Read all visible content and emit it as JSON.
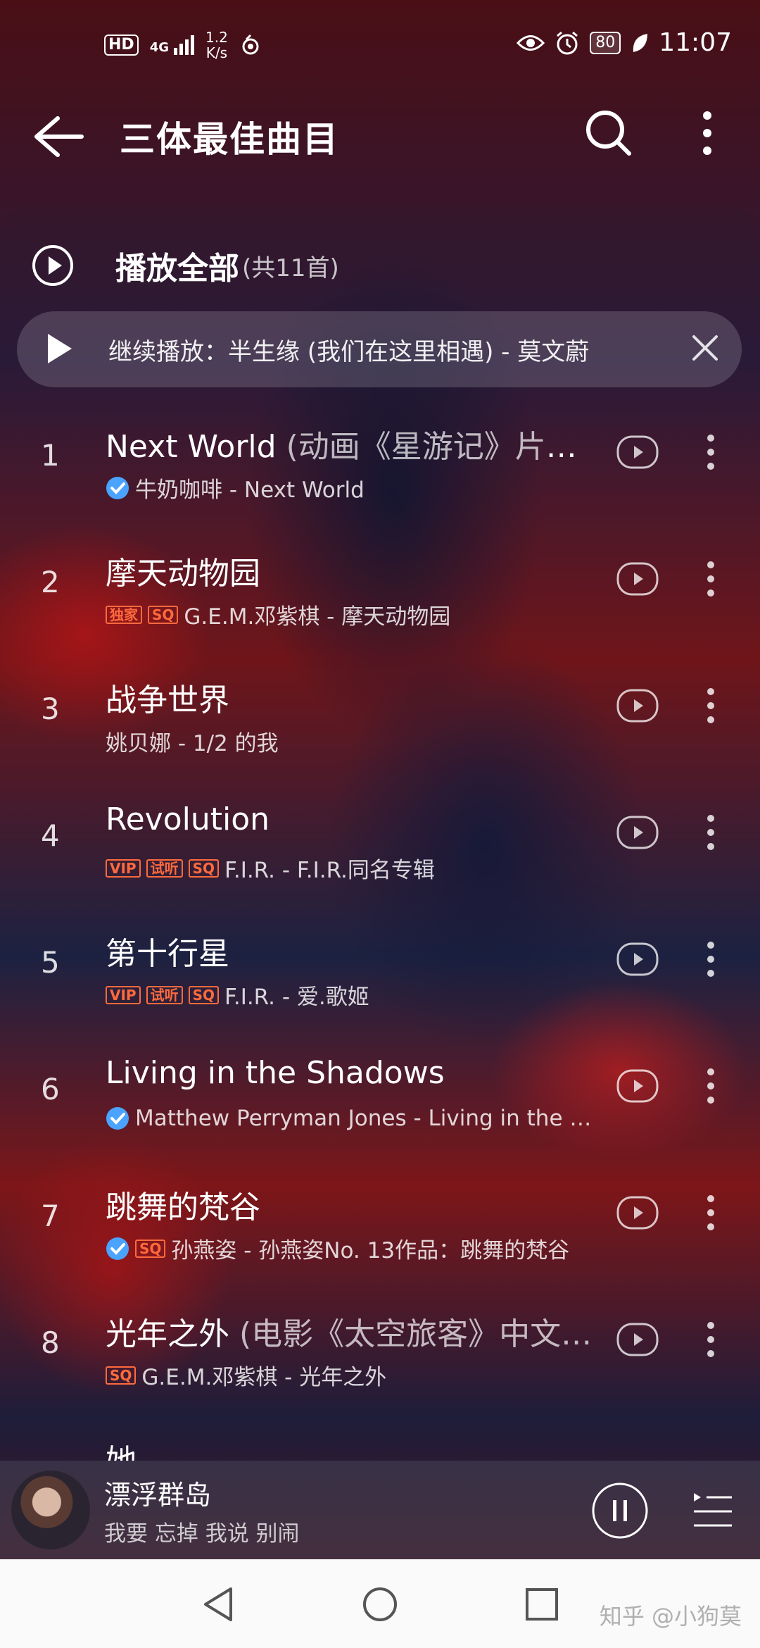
{
  "status_bar": {
    "network_badge": "HD",
    "signal": "4G",
    "net_speed": "1.2",
    "net_unit": "K/s",
    "battery": "80",
    "time": "11:07"
  },
  "header": {
    "title": "三体最佳曲目"
  },
  "play_all": {
    "label": "播放全部",
    "count": "(共11首)"
  },
  "resume": {
    "label": "继续播放：半生缘 (我们在这里相遇) - 莫文蔚"
  },
  "songs": [
    {
      "index": "1",
      "title": "Next World",
      "suffix": " (动画《星游记》片尾…",
      "meta": "牛奶咖啡 - Next World"
    },
    {
      "index": "2",
      "title": "摩天动物园",
      "suffix": "",
      "meta": "G.E.M.邓紫棋 - 摩天动物园",
      "tags": [
        "独家",
        "SQ"
      ]
    },
    {
      "index": "3",
      "title": "战争世界",
      "suffix": "",
      "meta": "姚贝娜 - 1/2 的我"
    },
    {
      "index": "4",
      "title": "Revolution",
      "suffix": "",
      "meta": "F.I.R. - F.I.R.同名专辑",
      "tags": [
        "VIP",
        "试听",
        "SQ"
      ]
    },
    {
      "index": "5",
      "title": "第十行星",
      "suffix": "",
      "meta": "F.I.R. - 爱.歌姬",
      "tags": [
        "VIP",
        "试听",
        "SQ"
      ]
    },
    {
      "index": "6",
      "title": "Living in the Shadows",
      "suffix": "",
      "meta": "Matthew Perryman Jones - Living in the S…"
    },
    {
      "index": "7",
      "title": "跳舞的梵谷",
      "suffix": "",
      "meta": "孙燕姿 - 孙燕姿No. 13作品：跳舞的梵谷",
      "tags": [
        "SQ"
      ]
    },
    {
      "index": "8",
      "title": "光年之外",
      "suffix": " (电影《太空旅客》中文…",
      "meta": "G.E.M.邓紫棋 - 光年之外",
      "tags": [
        "SQ"
      ]
    },
    {
      "index": "",
      "title": "她",
      "suffix": "",
      "meta": ""
    }
  ],
  "mini_player": {
    "title": "漂浮群岛",
    "lyric": "我要 忘掉 我说 别闹"
  },
  "watermark": "知乎 @小狗莫",
  "colors": {
    "accent_tag": "#ff6a3d",
    "verified": "#4aa3ff"
  }
}
